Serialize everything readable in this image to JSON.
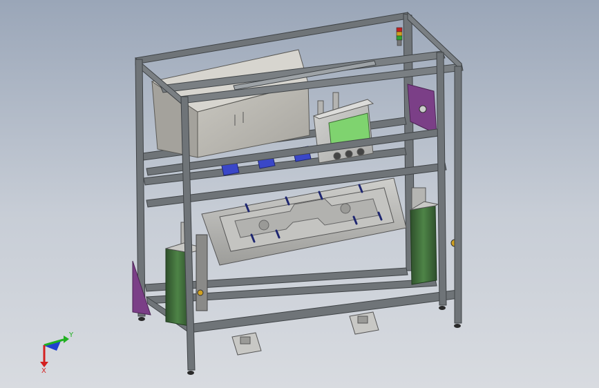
{
  "colors": {
    "background_top": "#9aa6b8",
    "background_bottom": "#d8dbe0",
    "frame": "#6f7478",
    "frame_dark": "#3f4346",
    "cabinet": "#b9b7b0",
    "control_box": "#c6c6c4",
    "screen": "#7fd36f",
    "panel_purple": "#7b3f87",
    "fixture_blue": "#3a47c8",
    "cylinder_green": "#3f6b3a",
    "axis_x": "#d42020",
    "axis_y": "#20b020",
    "axis_z": "#2040d0"
  },
  "triad": {
    "x_label": "X",
    "y_label": "Y"
  }
}
